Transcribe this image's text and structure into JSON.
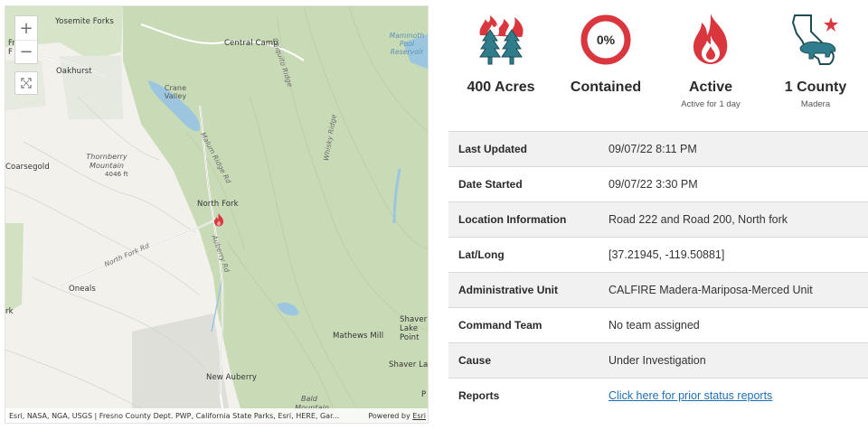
{
  "map": {
    "zoom_in": "+",
    "zoom_out": "−",
    "labels": {
      "yosemite_forks": "Yosemite Forks",
      "central_camp": "Central Camp",
      "mammoth_pool": "Mammoth Pool Reservoir",
      "oakhurst": "Oakhurst",
      "crane_valley": "Crane Valley",
      "chiquito_ridge": "Chiquito Ridge",
      "whisky_ridge": "Whisky Ridge",
      "thornberry_mountain": "Thornberry Mountain",
      "thornberry_elev": "4046 ft",
      "coarsegold": "Coarsegold",
      "north_fork": "North Fork",
      "north_fork_rd": "North Fork Rd",
      "malum_ridge_rd": "Malum Ridge Rd",
      "auberry_rd": "Auberry Rd",
      "oneals": "Oneals",
      "mathews_mill": "Mathews Mill",
      "shaver_lake_point": "Shaver Lake Point",
      "shaver_lake": "Shaver Lake",
      "new_auberry": "New Auberry",
      "bald_mountain": "Bald Mountain",
      "left_edge_fr": "Fr",
      "left_edge_f": "F",
      "left_edge_rk": "rk",
      "right_edge_p": "P"
    },
    "attribution": "Esri, NASA, NGA, USGS | Fresno County Dept. PWP, California State Parks, Esri, HERE, Gar...",
    "powered_by": "Powered by",
    "powered_link": "Esri"
  },
  "stats": {
    "acres": {
      "value": "400 Acres",
      "icon": "trees-fire-icon"
    },
    "contained": {
      "percent": "0%",
      "value": "Contained",
      "fill_fraction": 0.0,
      "icon": "containment-ring-icon"
    },
    "active": {
      "value": "Active",
      "sub": "Active for 1 day",
      "icon": "flame-icon"
    },
    "county": {
      "value": "1 County",
      "sub": "Madera",
      "icon": "california-bear-icon"
    }
  },
  "table": {
    "rows": [
      {
        "label": "Last Updated",
        "value": "09/07/22 8:11 PM"
      },
      {
        "label": "Date Started",
        "value": "09/07/22 3:30 PM"
      },
      {
        "label": "Location Information",
        "value": "Road 222 and Road 200, North fork"
      },
      {
        "label": "Lat/Long",
        "value": "[37.21945, -119.50881]"
      },
      {
        "label": "Administrative Unit",
        "value": "CALFIRE Madera-Mariposa-Merced Unit"
      },
      {
        "label": "Command Team",
        "value": "No team assigned"
      },
      {
        "label": "Cause",
        "value": "Under Investigation"
      },
      {
        "label": "Reports",
        "value": "Click here for prior status reports"
      }
    ]
  },
  "colors": {
    "fire_red": "#d9363e",
    "tree_teal": "#2f7d8c",
    "link_blue": "#1f6fb5",
    "forest_green": "#c9dcb8",
    "water_blue": "#9cc6e0"
  }
}
